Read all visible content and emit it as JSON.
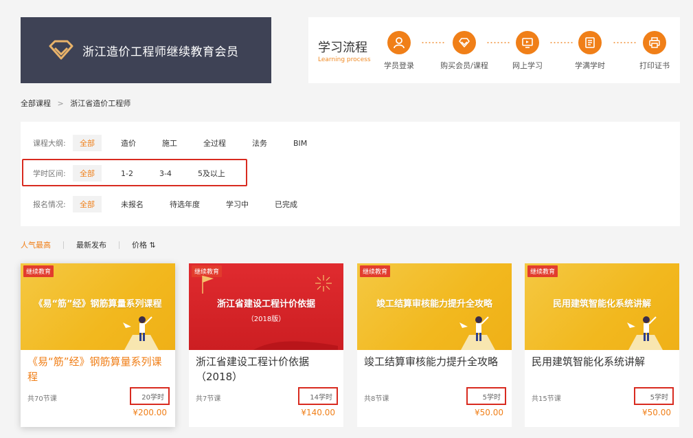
{
  "header": {
    "banner_title": "浙江造价工程师继续教育会员",
    "process_title": "学习流程",
    "process_subtitle": "Learning process",
    "steps": [
      {
        "label": "学员登录",
        "icon": "user-icon"
      },
      {
        "label": "购买会员/课程",
        "icon": "diamond-icon"
      },
      {
        "label": "网上学习",
        "icon": "monitor-icon"
      },
      {
        "label": "学满学时",
        "icon": "document-icon"
      },
      {
        "label": "打印证书",
        "icon": "printer-icon"
      }
    ]
  },
  "breadcrumb": {
    "root": "全部课程",
    "separator": ">",
    "current": "浙江省造价工程师"
  },
  "filters": {
    "outline": {
      "label": "课程大纲:",
      "options": [
        "全部",
        "造价",
        "施工",
        "全过程",
        "法务",
        "BIM"
      ]
    },
    "hours": {
      "label": "学时区间:",
      "options": [
        "全部",
        "1-2",
        "3-4",
        "5及以上"
      ]
    },
    "status": {
      "label": "报名情况:",
      "options": [
        "全部",
        "未报名",
        "待选年度",
        "学习中",
        "已完成"
      ]
    }
  },
  "sort": {
    "popular": "人气最高",
    "newest": "最新发布",
    "price": "价格 ⇅"
  },
  "courses": [
    {
      "tag": "继续教育",
      "thumb_title": "《易“筋”经》钢筋算量系列课程",
      "thumb_sub": "",
      "title": "《易“筋”经》钢筋算量系列课程",
      "lessons": "共70节课",
      "hours": "20学时",
      "price": "¥200.00"
    },
    {
      "tag": "继续教育",
      "thumb_title": "浙江省建设工程计价依据",
      "thumb_sub": "（2018版）",
      "title": "浙江省建设工程计价依据（2018）",
      "lessons": "共7节课",
      "hours": "14学时",
      "price": "¥140.00"
    },
    {
      "tag": "继续教育",
      "thumb_title": "竣工结算审核能力提升全攻略",
      "thumb_sub": "",
      "title": "竣工结算审核能力提升全攻略",
      "lessons": "共8节课",
      "hours": "5学时",
      "price": "¥50.00"
    },
    {
      "tag": "继续教育",
      "thumb_title": "民用建筑智能化系统讲解",
      "thumb_sub": "",
      "title": "民用建筑智能化系统讲解",
      "lessons": "共15节课",
      "hours": "5学时",
      "price": "¥50.00"
    }
  ],
  "colors": {
    "accent": "#f07f18",
    "highlight_box": "#d82a1f",
    "banner_bg": "#3e4255",
    "tag_red": "#e23c2d"
  }
}
